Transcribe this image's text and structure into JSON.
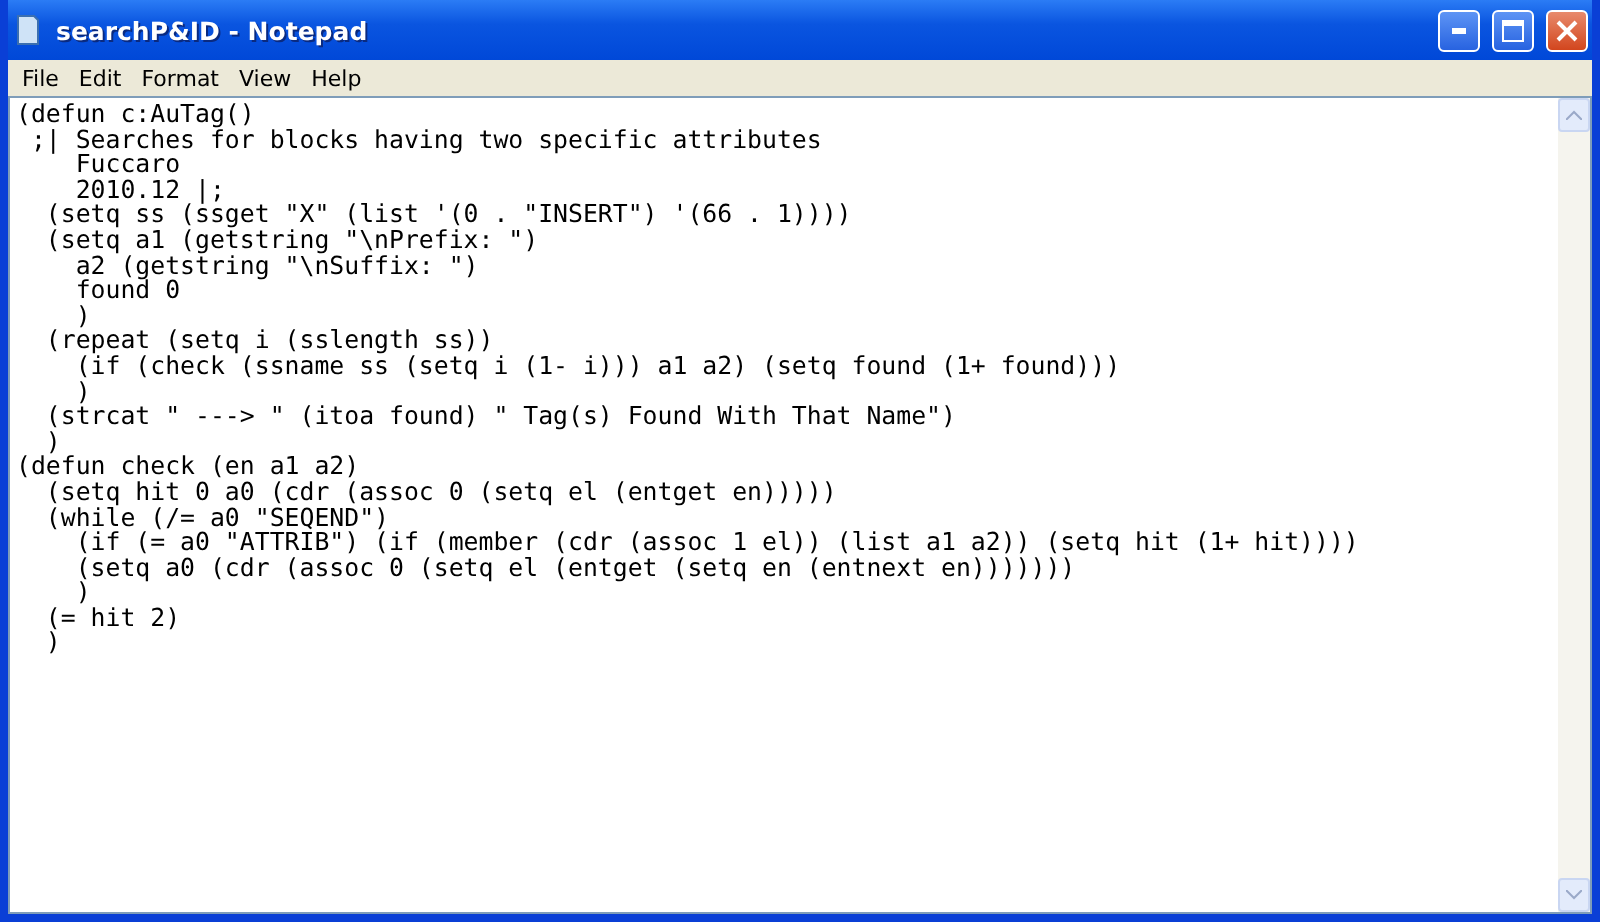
{
  "window": {
    "title": "searchP&ID - Notepad"
  },
  "menu": [
    "File",
    "Edit",
    "Format",
    "View",
    "Help"
  ],
  "editor": {
    "lines": [
      "(defun c:AuTag()",
      " ;| Searches for blocks having two specific attributes",
      "    Fuccaro",
      "    2010.12 |;",
      "  (setq ss (ssget \"X\" (list '(0 . \"INSERT\") '(66 . 1))))",
      "  (setq a1 (getstring \"\\nPrefix: \")",
      "    a2 (getstring \"\\nSuffix: \")",
      "    found 0",
      "    )",
      "  (repeat (setq i (sslength ss))",
      "    (if (check (ssname ss (setq i (1- i))) a1 a2) (setq found (1+ found)))",
      "    )",
      "  (strcat \" ---> \" (itoa found) \" Tag(s) Found With That Name\")",
      "  )",
      "(defun check (en a1 a2)",
      "  (setq hit 0 a0 (cdr (assoc 0 (setq el (entget en)))))",
      "  (while (/= a0 \"SEQEND\")",
      "    (if (= a0 \"ATTRIB\") (if (member (cdr (assoc 1 el)) (list a1 a2)) (setq hit (1+ hit))))",
      "    (setq a0 (cdr (assoc 0 (setq el (entget (setq en (entnext en)))))))",
      "    )",
      "  (= hit 2)",
      "  )"
    ]
  }
}
